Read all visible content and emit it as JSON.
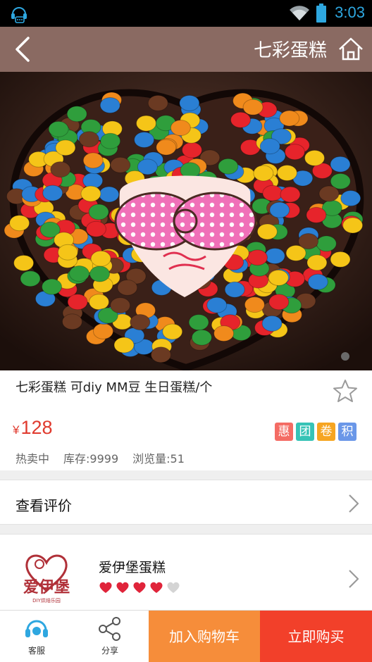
{
  "status_bar": {
    "time": "3:03",
    "icons": [
      "notification-headset-icon",
      "wifi-icon",
      "battery-icon"
    ]
  },
  "title_bar": {
    "title": "七彩蛋糕",
    "back_icon": "chevron-left-icon",
    "home_icon": "home-icon"
  },
  "product": {
    "name": "七彩蛋糕 可diy MM豆 生日蛋糕/个",
    "currency": "¥",
    "price": "128",
    "tags": [
      {
        "label": "惠",
        "color": "#f46c64"
      },
      {
        "label": "团",
        "color": "#36c3b6"
      },
      {
        "label": "卷",
        "color": "#f6a521"
      },
      {
        "label": "积",
        "color": "#6a97e8"
      }
    ],
    "stats": {
      "hot": "热卖中",
      "stock": "库存:9999",
      "views": "浏览量:51"
    }
  },
  "reviews": {
    "label": "查看评价"
  },
  "shop": {
    "name": "爱伊堡蛋糕",
    "logo_text": "爱伊堡",
    "logo_subtext": "DIY烘焙乐园",
    "rating": {
      "filled": 4,
      "total": 5
    }
  },
  "bottom_bar": {
    "service_label": "客服",
    "share_label": "分享",
    "add_to_cart": "加入购物车",
    "buy_now": "立即购买"
  },
  "colors": {
    "title_bar": "#8a6a62",
    "price": "#e03a2e",
    "cart": "#f68d3a",
    "buy": "#f2402a",
    "heart_filled": "#e0243a",
    "heart_empty": "#d4d4d4"
  }
}
